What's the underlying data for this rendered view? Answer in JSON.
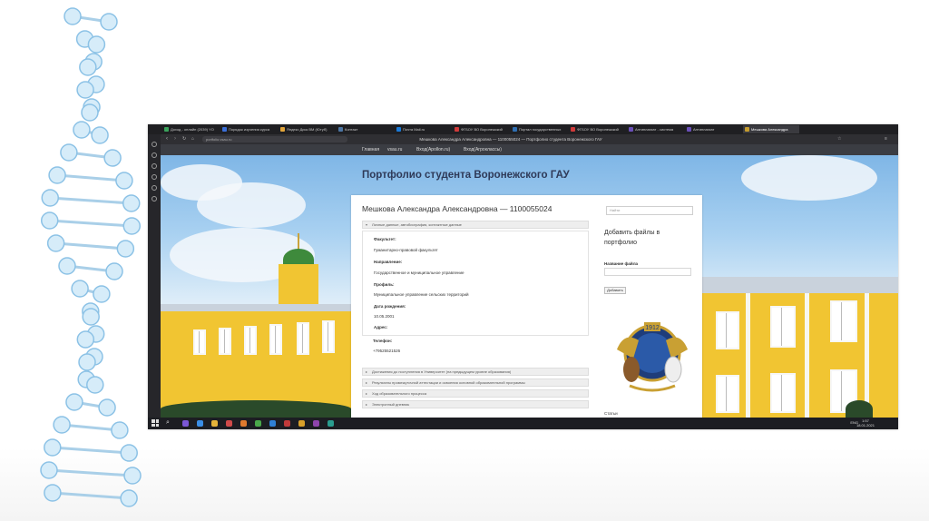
{
  "browser": {
    "tabs": [
      {
        "label": "Доход - онлайн (2039) YO",
        "color": "#3aa35b"
      },
      {
        "label": "Порядок изучения курса",
        "color": "#3a6fd8"
      },
      {
        "label": "Яндекс Диск ВМ (Ютуб)",
        "color": "#e2a53a"
      },
      {
        "label": "Контакт",
        "color": "#4c75a3"
      },
      {
        "label": "Почта Mail.ru",
        "color": "#1a7ad8"
      },
      {
        "label": "ФГБОУ ВО Воронежский",
        "color": "#d03a3a"
      },
      {
        "label": "Портал государственных",
        "color": "#2f6fb3"
      },
      {
        "label": "ФГБОУ ВО Воронежский",
        "color": "#d03a3a"
      },
      {
        "label": "Антиплагиат - система",
        "color": "#6a4fb8"
      },
      {
        "label": "Антиплагиат",
        "color": "#6a4fb8"
      },
      {
        "label": "Мешкова Александра",
        "color": "#c59c2e"
      }
    ],
    "url": "portfolio.vsau.ru",
    "page_title": "Мешкова Александра Александровна — 1100055024 — Портфолио студента Воронежского ГАУ"
  },
  "nav": {
    "links": [
      "Главная",
      "vsau.ru",
      "Вход(Apollon.ru)",
      "Вход(Агроклассы)"
    ]
  },
  "site": {
    "title": "Портфолио студента Воронежского ГАУ"
  },
  "profile": {
    "heading": "Мешкова Александра Александровна — 1100055024",
    "section_open": "Личные данные, автобиография, контактные данные",
    "fields": [
      {
        "label": "Факультет:",
        "value": "Гуманитарно-правовой факультет"
      },
      {
        "label": "Направление:",
        "value": "Государственное и муниципальное управление"
      },
      {
        "label": "Профиль:",
        "value": "Муниципальное управление сельских территорий"
      },
      {
        "label": "Дата рождения:",
        "value": "10.05.2001"
      },
      {
        "label": "Адрес:",
        "value": ""
      },
      {
        "label": "Телефон:",
        "value": "+79525521526"
      }
    ],
    "sections_collapsed": [
      "Достижения до поступления в Университет (на предыдущем уровне образования)",
      "Результаты промежуточной аттестации и освоения основной образовательной программы",
      "Ход образовательного процесса",
      "Электронный дневник"
    ]
  },
  "sidebar": {
    "search_placeholder": "Найти",
    "add_files_title": "Добавить файлы в портфолио",
    "file_name_label": "Название файла",
    "add_button": "Добавить",
    "more_label": "Статьи",
    "emblem_year": "1912"
  },
  "taskbar": {
    "lang": "ENG",
    "time": "1:57",
    "date": "18.01.2021"
  }
}
